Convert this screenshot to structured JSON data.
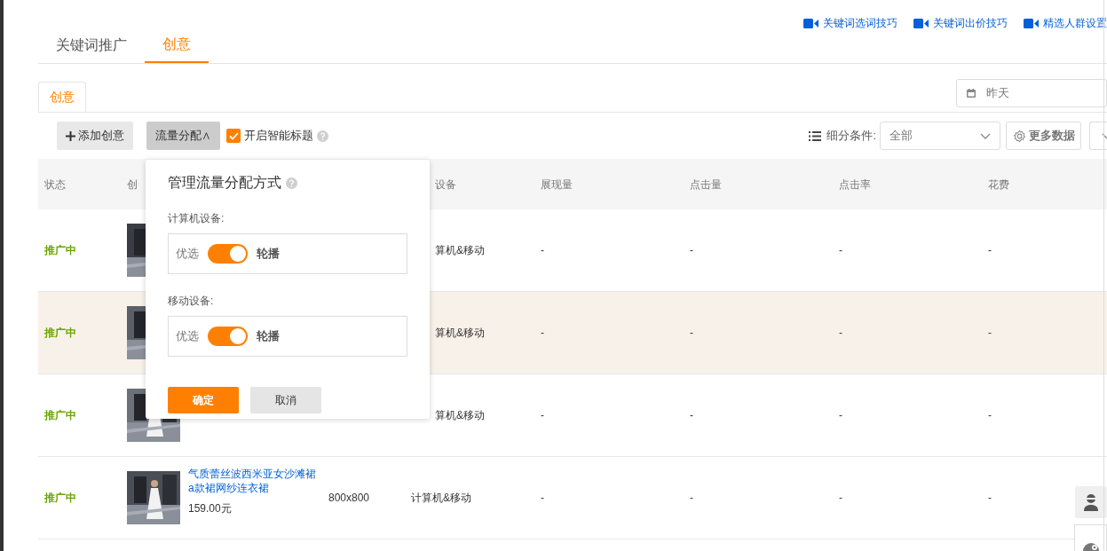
{
  "top_tabs": [
    {
      "label": "关键词推广",
      "selected": false
    },
    {
      "label": "创意",
      "selected": true
    }
  ],
  "help_links": [
    "关键词选词技巧",
    "关键词出价技巧",
    "精选人群设置"
  ],
  "sub_tab": {
    "label": "创意",
    "selected": true
  },
  "date_field": {
    "value": "昨天"
  },
  "toolbar": {
    "add_button": "添加创意",
    "traffic_button": "流量分配∧",
    "smart_title": {
      "label": "开启智能标题",
      "checked": true
    },
    "filter_label": "细分条件:",
    "filter_value": "全部",
    "more_data": "更多数据"
  },
  "table": {
    "columns": [
      "状态",
      "创",
      "",
      "设备",
      "展现量",
      "点击量",
      "点击率",
      "花费"
    ],
    "rows": [
      {
        "kind": "covered",
        "status": "推广中",
        "device": "算机&移动",
        "metrics": [
          "-",
          "-",
          "-",
          "-"
        ],
        "highlighted": false
      },
      {
        "kind": "covered",
        "status": "推广中",
        "device": "算机&移动",
        "metrics": [
          "-",
          "-",
          "-",
          "-"
        ],
        "highlighted": true
      },
      {
        "kind": "covered",
        "status": "推广中",
        "device": "算机&移动",
        "metrics": [
          "-",
          "-",
          "-",
          "-"
        ],
        "highlighted": false
      },
      {
        "kind": "full",
        "status": "推广中",
        "title": "气质蕾丝波西米亚女沙滩裙a款裙网纱连衣裙",
        "price": "159.00元",
        "size": "800x800",
        "device": "计算机&移动",
        "metrics": [
          "-",
          "-",
          "-",
          "-"
        ],
        "highlighted": false
      }
    ]
  },
  "popup": {
    "title": "管理流量分配方式",
    "sections": [
      {
        "label": "计算机设备:",
        "left": "优选",
        "right": "轮播",
        "on": true
      },
      {
        "label": "移动设备:",
        "left": "优选",
        "right": "轮播",
        "on": true
      }
    ],
    "ok": "确定",
    "cancel": "取消"
  }
}
